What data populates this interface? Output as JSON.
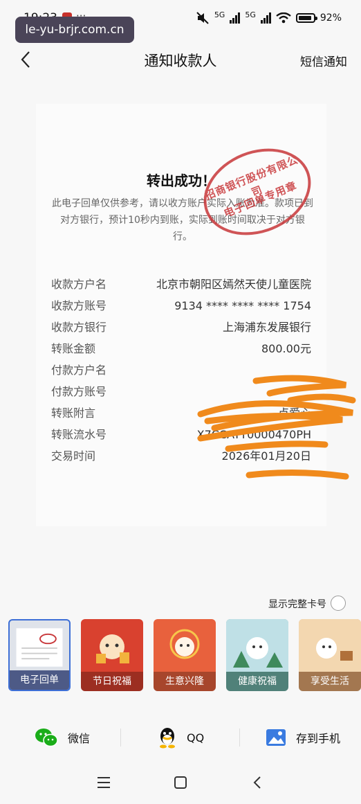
{
  "status_bar": {
    "time": "19:23",
    "dots": "···",
    "watermark_url": "le-yu-brjr.com.cn",
    "signal_label_1": "5G",
    "signal_label_2": "5G",
    "battery_percent": "92%"
  },
  "nav": {
    "title": "通知收款人",
    "right_action": "短信通知"
  },
  "receipt": {
    "title": "转出成功！",
    "note": "此电子回单仅供参考，请以收方账户实际入账为准。款项已到对方银行，预计10秒内到账，实际到账时间取决于对方银行。",
    "seal_top": "招商银行股份有限公司",
    "seal_bottom": "电子回单专用章",
    "fields": [
      {
        "label": "收款方户名",
        "value": "北京市朝阳区嫣然天使儿童医院"
      },
      {
        "label": "收款方账号",
        "value": "9134 **** **** **** 1754"
      },
      {
        "label": "收款方银行",
        "value": "上海浦东发展银行"
      },
      {
        "label": "转账金额",
        "value": "800.00元"
      },
      {
        "label": "付款方户名",
        "value": ""
      },
      {
        "label": "付款方账号",
        "value": ""
      },
      {
        "label": "转账附言",
        "value": "点爱心"
      },
      {
        "label": "转账流水号",
        "value": "X7CCATT0000470PH"
      },
      {
        "label": "交易时间",
        "value": "2026年01月20日"
      }
    ]
  },
  "full_card_toggle": {
    "label": "显示完整卡号"
  },
  "themes": [
    {
      "label": "电子回单",
      "color": "#dfe3ea",
      "selected": true
    },
    {
      "label": "节日祝福",
      "color": "#d9412f"
    },
    {
      "label": "生意兴隆",
      "color": "#e8613d"
    },
    {
      "label": "健康祝福",
      "color": "#6fb3a8"
    },
    {
      "label": "享受生活",
      "color": "#e2a670"
    }
  ],
  "share": {
    "wechat": "微信",
    "qq": "QQ",
    "save": "存到手机"
  },
  "colors": {
    "seal_red": "#c8373a",
    "scribble_orange": "#f08a1c",
    "selected_blue": "#3d6fd6"
  }
}
